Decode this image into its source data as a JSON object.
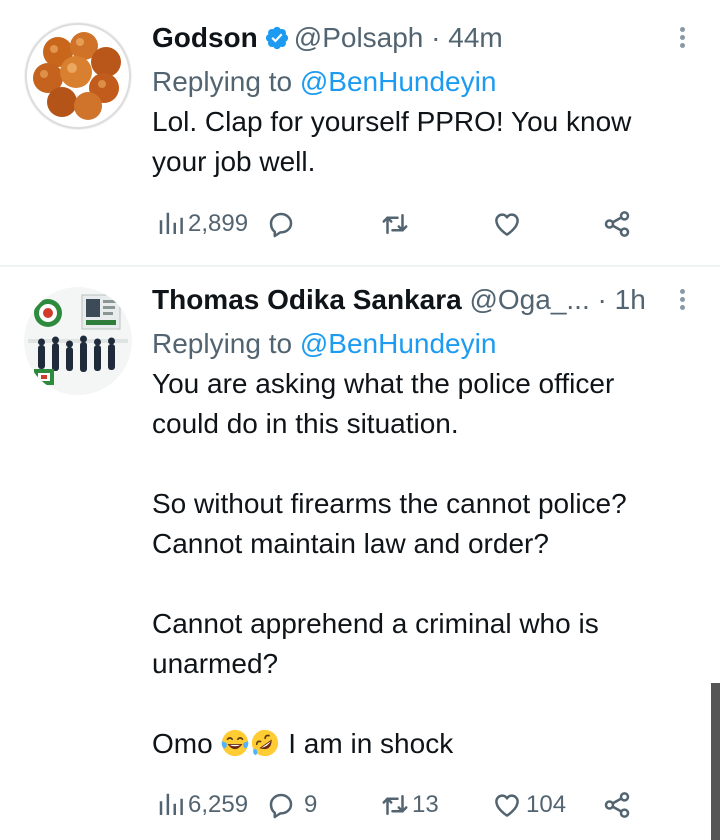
{
  "tweets": [
    {
      "name": "Godson",
      "verified": true,
      "handle": "@Polsaph",
      "dot": "·",
      "time": "44m",
      "replying_prefix": "Replying to",
      "replying_to": "@BenHundeyin",
      "lines": [
        "Lol. Clap for yourself PPRO! You know",
        "your job well."
      ],
      "views": "2,899",
      "replies": "",
      "retweets": "",
      "likes": ""
    },
    {
      "name": "Thomas Odika Sankara",
      "verified": false,
      "handle": "@Oga_...",
      "dot": "·",
      "time": "1h",
      "replying_prefix": "Replying to",
      "replying_to": "@BenHundeyin",
      "paragraphs": [
        [
          "You are asking what the police officer",
          "could do in this situation."
        ],
        [
          "So without firearms the cannot police?",
          "Cannot maintain law and order?"
        ],
        [
          "Cannot apprehend a criminal who is",
          "unarmed?"
        ]
      ],
      "last_line_prefix": "Omo",
      "last_line_emojis": [
        "face-with-tears-of-joy",
        "rolling-on-the-floor-laughing"
      ],
      "last_line_suffix": "I am in shock",
      "views": "6,259",
      "replies": "9",
      "retweets": "13",
      "likes": "104"
    }
  ],
  "colors": {
    "accent": "#1d9bf0",
    "secondary_text": "#536471",
    "primary_text": "#0f1419",
    "divider": "#eff3f4"
  }
}
